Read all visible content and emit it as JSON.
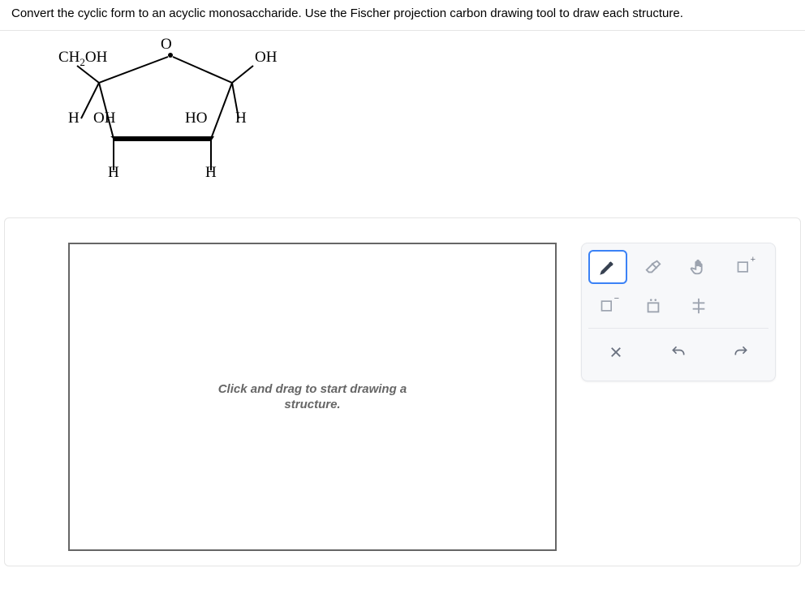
{
  "question": "Convert the cyclic form to an acyclic monosaccharide. Use the Fischer projection carbon drawing tool to draw each structure.",
  "structure": {
    "top_O": "O",
    "anomeric_OH": "OH",
    "c2_HO": "HO",
    "c2_H_out": "H",
    "c2_H_down": "H",
    "c3_H_down": "H",
    "c4_H_out": "H",
    "c4_OH": "OH",
    "ch2oh": "CH",
    "ch2oh_sub": "2",
    "ch2oh_tail": "OH"
  },
  "canvas": {
    "placeholder_line1": "Click and drag to start drawing a",
    "placeholder_line2": "structure."
  },
  "tools": {
    "pencil": "pencil-icon",
    "eraser": "eraser-icon",
    "hand": "hand-icon",
    "box_plus": "box-plus-icon",
    "box_minus": "box-minus-icon",
    "box_dots": "box-dots-icon",
    "fischer": "fischer-icon",
    "close": "close-icon",
    "undo": "undo-icon",
    "redo": "redo-icon"
  }
}
